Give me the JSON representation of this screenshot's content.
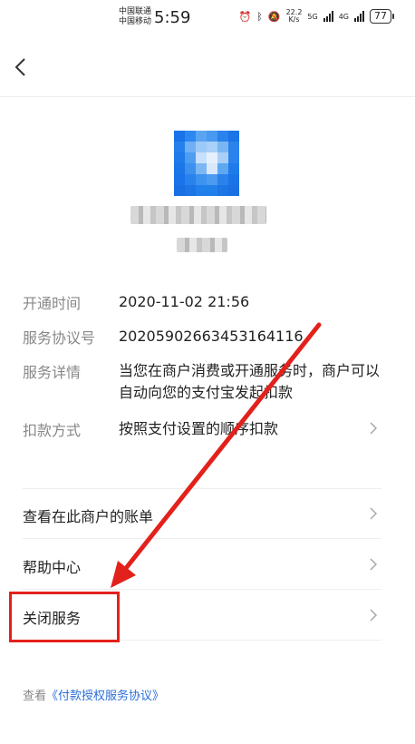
{
  "status_bar": {
    "carrier1": "中国联通",
    "carrier2": "中国移动",
    "time": "5:59",
    "net_speed_value": "22.2",
    "net_speed_unit": "K/s",
    "sig1": "5G",
    "sig2": "4G",
    "battery": "77"
  },
  "nav": {
    "back_icon": "chevron-left-icon"
  },
  "details": [
    {
      "key": "开通时间",
      "value": "2020-11-02 21:56"
    },
    {
      "key": "服务协议号",
      "value": "20205902663453164116"
    },
    {
      "key": "服务详情",
      "value": "当您在商户消费或开通服务时，商户可以自动向您的支付宝发起扣款"
    },
    {
      "key": "扣款方式",
      "value": "按照支付设置的顺序扣款"
    }
  ],
  "menu": [
    {
      "label": "查看在此商户的账单"
    },
    {
      "label": "帮助中心"
    },
    {
      "label": "关闭服务"
    }
  ],
  "footer": {
    "prefix": "查看",
    "link": "《付款授权服务协议》"
  },
  "colors": {
    "annotation_red": "#e3211c",
    "link_blue": "#2b6ed8",
    "logo_blue": "#1f7ce8"
  }
}
